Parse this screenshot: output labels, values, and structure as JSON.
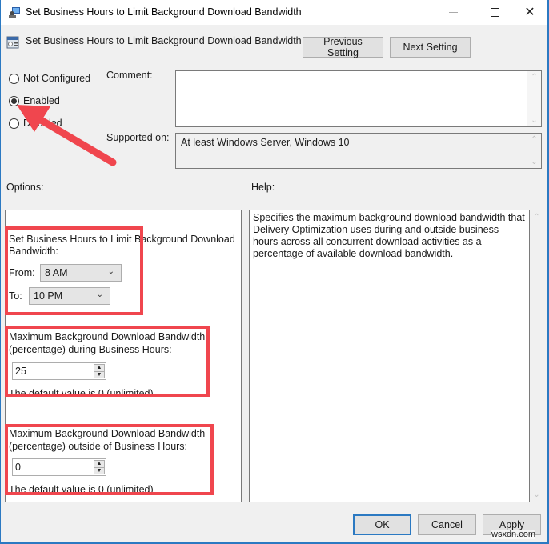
{
  "window": {
    "title": "Set Business Hours to Limit Background Download Bandwidth",
    "controls": {
      "minimize": "minimize",
      "maximize": "maximize",
      "close": "✕"
    }
  },
  "header": {
    "title": "Set Business Hours to Limit Background Download Bandwidth",
    "previous_label": "Previous Setting",
    "next_label": "Next Setting"
  },
  "state": {
    "options": [
      {
        "label": "Not Configured",
        "checked": false
      },
      {
        "label": "Enabled",
        "checked": true
      },
      {
        "label": "Disabled",
        "checked": false
      }
    ]
  },
  "comment": {
    "label": "Comment:",
    "value": ""
  },
  "supported_on": {
    "label": "Supported on:",
    "value": "At least Windows Server, Windows 10"
  },
  "options_label": "Options:",
  "help_label": "Help:",
  "options": {
    "business_hours": {
      "heading_line1": "Set Business Hours to Limit Background Download",
      "heading_line2": "Bandwidth:",
      "from_label": "From:",
      "from_value": "8 AM",
      "to_label": "To:",
      "to_value": "10 PM"
    },
    "during": {
      "line1": "Maximum Background Download Bandwidth",
      "line2": "(percentage) during Business Hours:",
      "value": "25",
      "default_note": "The default value is 0 (unlimited)"
    },
    "outside": {
      "line1": "Maximum Background Download Bandwidth",
      "line2": "(percentage) outside of Business Hours:",
      "value": "0",
      "default_note": "The default value is 0 (unlimited)"
    }
  },
  "help": {
    "text": "Specifies the maximum background download bandwidth that Delivery Optimization uses during and outside business hours across all concurrent download activities as a percentage of available download bandwidth."
  },
  "footer": {
    "ok_label": "OK",
    "cancel_label": "Cancel",
    "apply_label": "Apply"
  },
  "annotations": {
    "highlight_color": "#f0464e",
    "arrow_color": "#f0464e",
    "arrow_target": "Enabled"
  },
  "watermark": "wsxdn.com",
  "icons": {
    "chevron_down": "⌄",
    "chevron_up": "⌃",
    "spin_up": "▲",
    "spin_down": "▼"
  }
}
